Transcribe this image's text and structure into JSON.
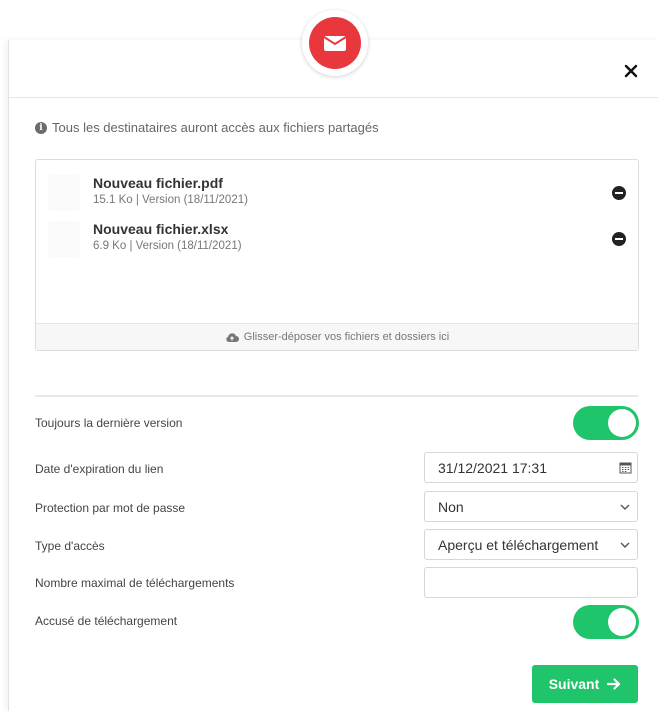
{
  "dialog": {
    "info_text": "Tous les destinataires auront accès aux fichiers partagés",
    "close_label": "✕"
  },
  "files": [
    {
      "name": "Nouveau fichier.pdf",
      "meta": "15.1 Ko | Version (18/11/2021)"
    },
    {
      "name": "Nouveau fichier.xlsx",
      "meta": "6.9 Ko | Version (18/11/2021)"
    }
  ],
  "dropzone_text": "Glisser-déposer vos fichiers et dossiers ici",
  "settings": {
    "latest_version": {
      "label": "Toujours la dernière version",
      "enabled": true
    },
    "expiration": {
      "label": "Date d'expiration du lien",
      "value": "31/12/2021 17:31"
    },
    "password": {
      "label": "Protection par mot de passe",
      "value": "Non"
    },
    "access_type": {
      "label": "Type d'accès",
      "value": "Aperçu et téléchargement"
    },
    "max_downloads": {
      "label": "Nombre maximal de téléchargements",
      "value": ""
    },
    "download_receipt": {
      "label": "Accusé de téléchargement",
      "enabled": true
    }
  },
  "next_button": {
    "label": "Suivant"
  },
  "colors": {
    "accent": "#1fc46b",
    "mail_badge": "#e8383d"
  }
}
